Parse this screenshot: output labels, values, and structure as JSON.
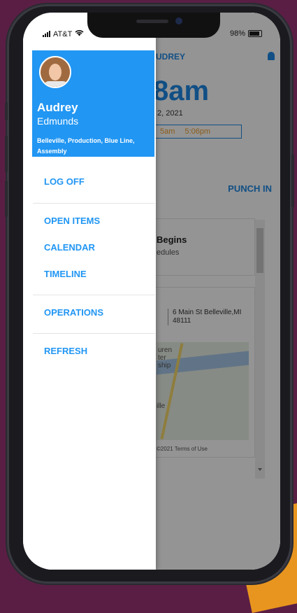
{
  "status": {
    "carrier": "AT&T",
    "battery": "98%"
  },
  "profile": {
    "first_name": "Audrey",
    "last_name": "Edmunds",
    "location": "Belleville, Production, Blue Line, Assembly"
  },
  "menu": {
    "log_off": "LOG OFF",
    "open_items": "OPEN ITEMS",
    "calendar": "CALENDAR",
    "timeline": "TIMELINE",
    "operations": "OPERATIONS",
    "refresh": "REFRESH"
  },
  "background": {
    "header_name": "UDREY",
    "big_time": "8am",
    "date": "2, 2021",
    "range_start": "5am",
    "range_end": "5:06pm",
    "punch": "PUNCH IN",
    "card_title": "Begins",
    "card_sub": "edules",
    "address": "6 Main St Belleville,MI 48111",
    "map_label": "uren\nter\nship",
    "map_label2": "ille",
    "map_footer": "©2021   Terms of Use"
  },
  "colors": {
    "accent": "#2196f3",
    "frame": "#1a1a1f",
    "backdrop": "#5a1e45"
  }
}
